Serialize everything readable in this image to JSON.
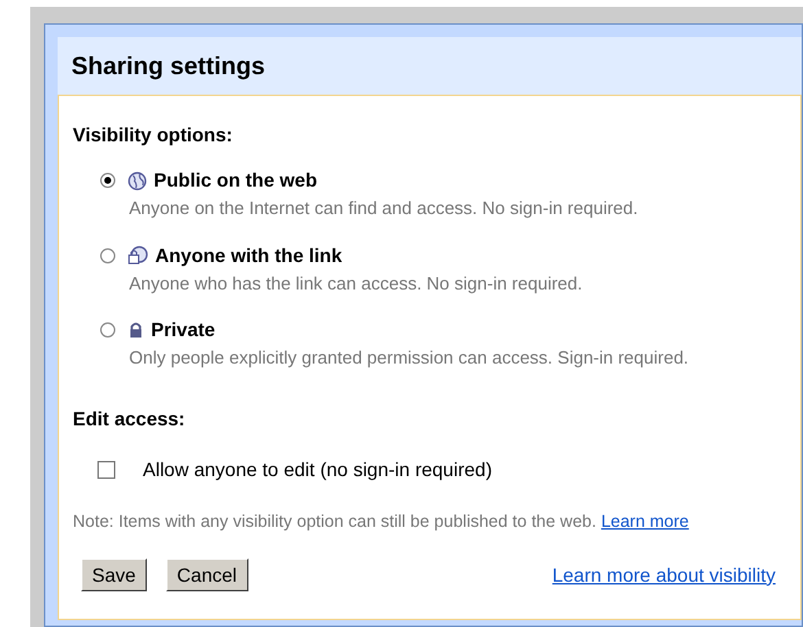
{
  "dialog": {
    "title": "Sharing settings"
  },
  "visibility": {
    "heading": "Visibility options:",
    "options": [
      {
        "kind": "globe",
        "label": "Public on the web",
        "description": "Anyone on the Internet can find and access. No sign-in required.",
        "selected": true
      },
      {
        "kind": "link",
        "label": "Anyone with the link",
        "description": "Anyone who has the link can access. No sign-in required.",
        "selected": false
      },
      {
        "kind": "lock",
        "label": "Private",
        "description": "Only people explicitly granted permission can access. Sign-in required.",
        "selected": false
      }
    ]
  },
  "edit_access": {
    "heading": "Edit access:",
    "checkbox": {
      "label": "Allow anyone to edit (no sign-in required)",
      "checked": false
    }
  },
  "note": {
    "text": "Note: Items with any visibility option can still be published to the web.",
    "link": "Learn more"
  },
  "buttons": [
    "Save",
    "Cancel"
  ],
  "footer_link": "Learn more about visibility"
}
